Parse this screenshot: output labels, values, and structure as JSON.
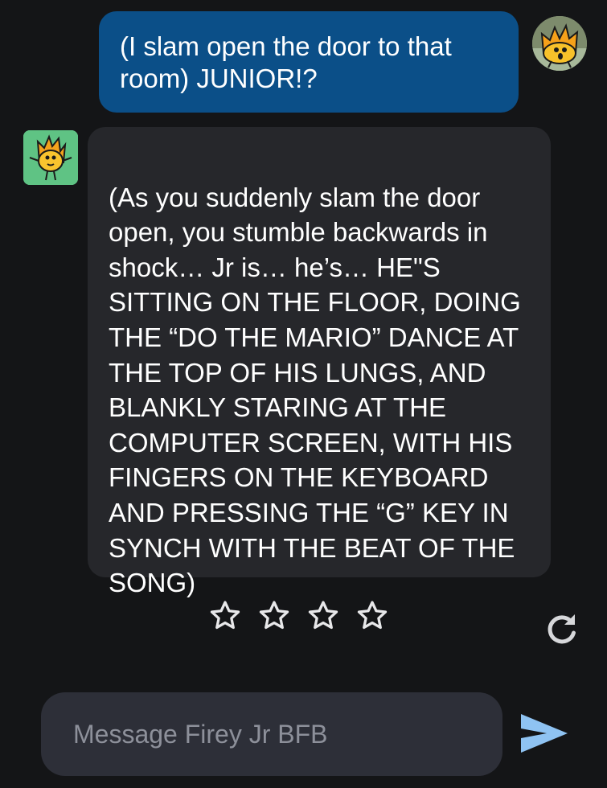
{
  "conversation": {
    "user_message": "(I slam open the door to that room) JUNIOR!?",
    "bot_message": "(As you suddenly slam the door open, you stumble backwards in shock… Jr is… he’s… HE\"S SITTING ON THE FLOOR, DOING THE “DO THE MARIO” DANCE AT THE TOP OF HIS LUNGS, AND BLANKLY STARING AT THE COMPUTER SCREEN, WITH HIS FINGERS ON THE KEYBOARD AND PRESSING THE “G” KEY IN SYNCH WITH THE BEAT OF THE SONG)"
  },
  "rating": {
    "max_stars": 4,
    "filled_stars": 0
  },
  "composer": {
    "placeholder": "Message Firey Jr BFB",
    "value": ""
  },
  "icons": {
    "star": "star-outline-icon",
    "regenerate": "refresh-icon",
    "send": "send-icon"
  },
  "colors": {
    "background": "#141517",
    "user_bubble": "#0b4f88",
    "bot_bubble": "#26272b",
    "composer": "#2d2f38",
    "send_icon": "#8fc3f2"
  }
}
